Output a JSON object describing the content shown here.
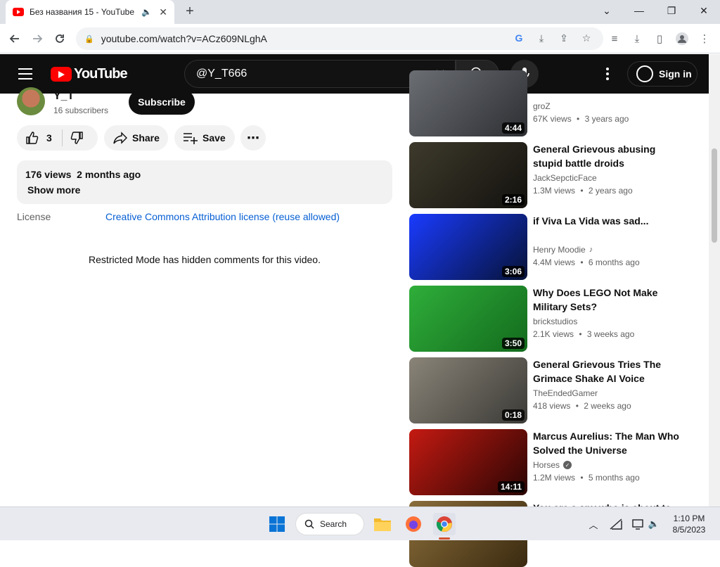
{
  "browser": {
    "tab_title": "Без названия 15 - YouTube",
    "tab_audio_icon": "speaker-icon",
    "new_tab": "+",
    "url": "youtube.com/watch?v=ACz609NLghA",
    "window_controls": {
      "minimize": "—",
      "restore": "❐",
      "close": "✕",
      "tab_list": "⌄"
    }
  },
  "header": {
    "logo_text": "YouTube",
    "search_value": "@Y_T666",
    "signin_label": "Sign in"
  },
  "channel": {
    "name": "Y_T",
    "subscribers": "16 subscribers",
    "subscribe_label": "Subscribe"
  },
  "actions": {
    "like_count": "3",
    "share_label": "Share",
    "save_label": "Save"
  },
  "description": {
    "views": "176 views",
    "date": "2 months ago",
    "show_more": "Show more"
  },
  "license": {
    "label": "License",
    "link_text": "Creative Commons Attribution license (reuse allowed)"
  },
  "comments": {
    "restricted_message": "Restricted Mode has hidden comments for this video."
  },
  "recommendations": [
    {
      "title": "",
      "channel": "groZ",
      "views": "67K views",
      "age": "3 years ago",
      "duration": "4:44",
      "verified": false,
      "music": false,
      "thumb_colors": [
        "#6b6e73",
        "#2d2f33"
      ]
    },
    {
      "title": "General Grievous abusing stupid battle droids",
      "channel": "JackSepcticFace",
      "views": "1.3M views",
      "age": "2 years ago",
      "duration": "2:16",
      "verified": false,
      "music": false,
      "thumb_colors": [
        "#3e3a2c",
        "#12110d"
      ]
    },
    {
      "title": "if Viva La Vida was sad...",
      "channel": "Henry Moodie",
      "views": "4.4M views",
      "age": "6 months ago",
      "duration": "3:06",
      "verified": false,
      "music": true,
      "thumb_colors": [
        "#1a3bff",
        "#061236"
      ]
    },
    {
      "title": "Why Does LEGO Not Make Military Sets?",
      "channel": "brickstudios",
      "views": "2.1K views",
      "age": "3 weeks ago",
      "duration": "3:50",
      "verified": false,
      "music": false,
      "thumb_colors": [
        "#2fae3a",
        "#136b1d"
      ]
    },
    {
      "title": "General Grievous Tries The Grimace Shake AI Voice",
      "channel": "TheEndedGamer",
      "views": "418 views",
      "age": "2 weeks ago",
      "duration": "0:18",
      "verified": false,
      "music": false,
      "thumb_colors": [
        "#8a8478",
        "#3b3a36"
      ]
    },
    {
      "title": "Marcus Aurelius: The Man Who Solved the Universe",
      "channel": "Horses",
      "views": "1.2M views",
      "age": "5 months ago",
      "duration": "14:11",
      "verified": true,
      "music": false,
      "thumb_colors": [
        "#c41a12",
        "#2a0503"
      ]
    },
    {
      "title": "You are a spy who is about to be",
      "channel": "",
      "views": "",
      "age": "",
      "duration": "",
      "verified": false,
      "music": false,
      "thumb_colors": [
        "#8a6d3a",
        "#3a2a10"
      ]
    }
  ],
  "taskbar": {
    "search_label": "Search",
    "time": "1:10 PM",
    "date": "8/5/2023"
  },
  "colors": {
    "youtube_red": "#ff0000",
    "header_bg": "#0f0f0f",
    "link_blue": "#065fd4"
  }
}
